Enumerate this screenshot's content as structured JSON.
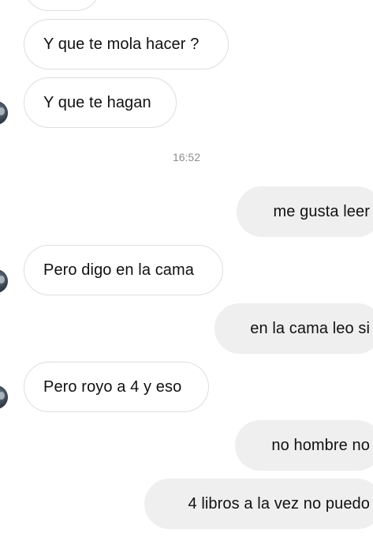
{
  "conversation": {
    "timestamp": "16:52",
    "messages": [
      {
        "direction": "incoming",
        "text": ""
      },
      {
        "direction": "incoming",
        "text": "Y que te mola hacer ?"
      },
      {
        "direction": "incoming",
        "text": "Y que te hagan"
      },
      {
        "direction": "outgoing",
        "text": "me gusta leer"
      },
      {
        "direction": "incoming",
        "text": "Pero digo en la cama"
      },
      {
        "direction": "outgoing",
        "text": "en la cama leo si"
      },
      {
        "direction": "incoming",
        "text": "Pero royo a 4 y eso"
      },
      {
        "direction": "outgoing",
        "text": "no hombre no"
      },
      {
        "direction": "outgoing",
        "text": "4 libros a la vez no puedo"
      }
    ]
  },
  "colors": {
    "incoming_bubble_bg": "#ffffff",
    "incoming_bubble_border": "#dedede",
    "outgoing_bubble_bg": "#efefef",
    "text": "#111111",
    "timestamp_text": "#8e8e8e"
  }
}
